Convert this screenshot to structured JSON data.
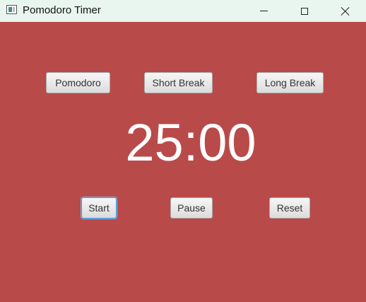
{
  "window": {
    "title": "Pomodoro Timer",
    "background_color": "#b94a4a",
    "icons": [
      "app-icon",
      "minimize-icon",
      "maximize-icon",
      "close-icon"
    ]
  },
  "modes": {
    "pomodoro_label": "Pomodoro",
    "short_break_label": "Short Break",
    "long_break_label": "Long Break"
  },
  "timer": {
    "display": "25:00"
  },
  "controls": {
    "start_label": "Start",
    "pause_label": "Pause",
    "reset_label": "Reset"
  }
}
